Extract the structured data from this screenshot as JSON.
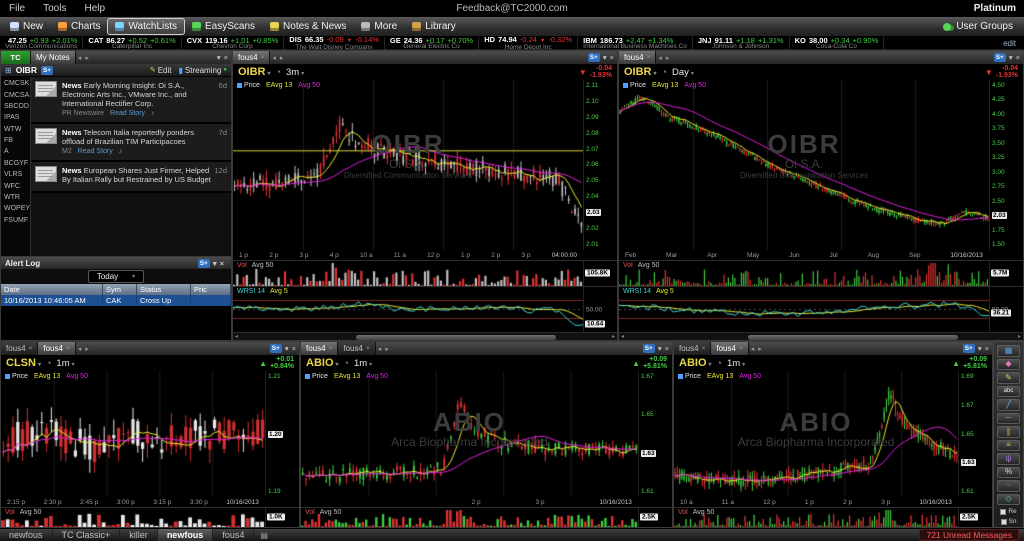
{
  "menubar": {
    "items": [
      "File",
      "Tools",
      "Help"
    ],
    "center": "Feedback@TC2000.com",
    "right": "Platinum"
  },
  "toolbar": {
    "buttons": [
      {
        "label": "New",
        "icon": "new-icon",
        "color": "#cfe2ff"
      },
      {
        "label": "Charts",
        "icon": "charts-icon",
        "color": "#ff9f40"
      },
      {
        "label": "WatchLists",
        "icon": "watchlists-icon",
        "color": "#7fd4ff",
        "active": true
      },
      {
        "label": "EasyScans",
        "icon": "easyscans-icon",
        "color": "#5ad45a"
      },
      {
        "label": "Notes & News",
        "icon": "notes-news-icon",
        "color": "#e8d44d"
      },
      {
        "label": "More",
        "icon": "more-icon",
        "color": "#bbbbbb"
      },
      {
        "label": "Library",
        "icon": "library-icon",
        "color": "#d4a24d"
      }
    ],
    "user_groups": {
      "label": "User Groups",
      "icon": "user-groups-icon",
      "color": "#5ad45a"
    }
  },
  "ticker": {
    "items": [
      {
        "symbol": "",
        "price": "47.25",
        "change": "+0.93",
        "pct": "+2.01%",
        "company": "Verizon Communications"
      },
      {
        "symbol": "CAT",
        "price": "86.27",
        "change": "+0.52",
        "pct": "+0.61%",
        "company": "Caterpillar Inc"
      },
      {
        "symbol": "CVX",
        "price": "119.16",
        "change": "+1.01",
        "pct": "+0.85%",
        "company": "Chevron Corp"
      },
      {
        "symbol": "DIS",
        "price": "66.35",
        "change": "-0.09",
        "pct": "-0.14%",
        "company": "The Walt Disney Company"
      },
      {
        "symbol": "GE",
        "price": "24.36",
        "change": "+0.17",
        "pct": "+0.70%",
        "company": "General Electric Co"
      },
      {
        "symbol": "HD",
        "price": "74.94",
        "change": "-0.24",
        "pct": "-0.32%",
        "company": "Home Depot Inc"
      },
      {
        "symbol": "IBM",
        "price": "186.73",
        "change": "+2.47",
        "pct": "+1.34%",
        "company": "International Business Machines Co"
      },
      {
        "symbol": "JNJ",
        "price": "91.11",
        "change": "+1.18",
        "pct": "+1.31%",
        "company": "Johnson & Johnson"
      },
      {
        "symbol": "KO",
        "price": "38.00",
        "change": "+0.34",
        "pct": "+0.90%",
        "company": "Coca-Cola Co"
      }
    ],
    "edit_link": "edit"
  },
  "watchlist": {
    "header": "TC",
    "symbols": [
      "CMCSK",
      "CMCSA",
      "SBCOD",
      "IPAS",
      "WTW",
      "FB",
      "A",
      "BCGYF",
      "VLRS",
      "WFC",
      "WTR",
      "WOPEY",
      "FSUMF"
    ]
  },
  "notes": {
    "title": "My Notes",
    "symbol": "OIBR",
    "edit_label": "Edit",
    "streaming_label": "Streaming",
    "items": [
      {
        "tag": "News",
        "headline": "Early Morning Insight: Oi S.A., Electronic Arts Inc., VMware Inc., and International Rectifier Corp.",
        "age": "6d",
        "source": "PR Newswire",
        "action": "Read Story"
      },
      {
        "tag": "News",
        "headline": "Telecom Italia reportedly ponders offload of Brazilian TIM Participacoes",
        "age": "7d",
        "source": "M2",
        "action": "Read Story"
      },
      {
        "tag": "News",
        "headline": "European Shares Just Firmer, Helped By Italian Rally but Restrained by US Budget",
        "age": "12d",
        "source": "",
        "action": ""
      }
    ]
  },
  "alert_log": {
    "title": "Alert Log",
    "filter": "Today",
    "columns": [
      "Date",
      "Sym",
      "Status",
      "Pric"
    ],
    "rows": [
      [
        "10/16/2013 10:46:05 AM",
        "CAK",
        "Cross Up",
        ""
      ]
    ]
  },
  "badges": {
    "splus": "S+"
  },
  "legend": {
    "price": "Price",
    "ema": "EAvg 13",
    "avg": "Avg 50"
  },
  "vol_legend": {
    "label1": "Vol",
    "label2": "Avg 50"
  },
  "wrsi_legend": {
    "label1": "WRSI 14",
    "label2": "Avg 5",
    "mid": "50.00"
  },
  "charts": {
    "main": {
      "tabs": [
        "fous4"
      ],
      "active_tab": 0,
      "symbol": "OIBR",
      "timeframe": "3m",
      "up": false,
      "change": "-0.04",
      "pct": "-1.93%",
      "y_labels": [
        "2.11",
        "2.10",
        "2.09",
        "2.08",
        "2.07",
        "2.06",
        "2.05",
        "2.04",
        "2.03",
        "2.02",
        "2.01"
      ],
      "box_index": 8,
      "times": [
        "1 p",
        "2 p",
        "3 p",
        "4 p",
        "10 a",
        "11 a",
        "12 p",
        "1 p",
        "2 p",
        "3 p",
        "04:00:00"
      ],
      "watermark": [
        "OIBR",
        "Oi S.A.",
        "Diversified Communication Services"
      ],
      "vol_value": "105.8K",
      "wrsi_value": "10.64",
      "wrsi_box_pos": 0.82
    },
    "daily": {
      "tabs": [
        "fous4"
      ],
      "active_tab": 0,
      "symbol": "OIBR",
      "timeframe": "Day",
      "up": false,
      "change": "-0.04",
      "pct": "-1.93%",
      "y_labels": [
        "4.50",
        "4.25",
        "4.00",
        "3.75",
        "3.50",
        "3.25",
        "3.00",
        "2.75",
        "2.50",
        "2.03",
        "1.75",
        "1.50"
      ],
      "box_index": 9,
      "times": [
        "Feb",
        "Mar",
        "Apr",
        "May",
        "Jun",
        "Jul",
        "Aug",
        "Sep",
        "10/16/2013"
      ],
      "watermark": [
        "OIBR",
        "Oi S.A.",
        "Diversified Communication Services"
      ],
      "vol_value": "5.7M",
      "wrsi_value": "36.21",
      "wrsi_box_pos": 0.58
    },
    "clsn": {
      "tabs": [
        "fous4",
        "fous4"
      ],
      "active_tab": 1,
      "symbol": "CLSN",
      "timeframe": "1m",
      "up": true,
      "change": "+0.01",
      "pct": "+0.84%",
      "y_labels": [
        "1.21",
        "1.20",
        "1.19"
      ],
      "box_index": 1,
      "times": [
        "2:15 p",
        "2:30 p",
        "2:45 p",
        "3:00 p",
        "3:15 p",
        "3:30 p",
        "10/16/2013"
      ],
      "vol_value": "1.0K"
    },
    "abio1": {
      "tabs": [
        "fous4",
        "fous4"
      ],
      "active_tab": 0,
      "symbol": "ABIO",
      "timeframe": "1m",
      "up": true,
      "change": "+0.09",
      "pct": "+5.81%",
      "y_labels": [
        "1.67",
        "1.65",
        "1.63",
        "1.61"
      ],
      "box_index": 2,
      "times": [
        "",
        "",
        "",
        "2 p",
        "3 p",
        "10/16/2013"
      ],
      "watermark": [
        "ABIO",
        "Arca Biopharma Incorporated"
      ],
      "vol_value": "2.5K"
    },
    "abio2": {
      "tabs": [
        "fous4",
        "fous4"
      ],
      "active_tab": 1,
      "symbol": "ABIO",
      "timeframe": "1m",
      "up": true,
      "change": "+0.09",
      "pct": "+5.81%",
      "y_labels": [
        "1.69",
        "1.67",
        "1.65",
        "1.63",
        "1.61"
      ],
      "box_index": 3,
      "times": [
        "10 a",
        "11 a",
        "12 p",
        "1 p",
        "2 p",
        "3 p",
        "10/16/2013"
      ],
      "watermark": [
        "ABIO",
        "Arca Biopharma Incorporated"
      ],
      "vol_value": "2.5K"
    }
  },
  "palette": {
    "tools": [
      {
        "name": "styles-icon",
        "glyph": "▦",
        "color": "#5aa0e0"
      },
      {
        "name": "eraser-icon",
        "glyph": "◆",
        "color": "#e07ab8"
      },
      {
        "name": "pencil-icon",
        "glyph": "✎",
        "color": "#e8d44d"
      },
      {
        "name": "text-note-icon",
        "glyph": "abc",
        "color": "#e8e8e8"
      },
      {
        "name": "trendline-icon",
        "glyph": "╱",
        "color": "#6fc0ff"
      },
      {
        "name": "horizontal-line-icon",
        "glyph": "─",
        "color": "#5ad45a"
      },
      {
        "name": "parallel-channel-icon",
        "glyph": "∥",
        "color": "#e8a04d"
      },
      {
        "name": "fibonacci-icon",
        "glyph": "≡",
        "color": "#d4b84d"
      },
      {
        "name": "pitchfork-icon",
        "glyph": "ψ",
        "color": "#b07ae0"
      },
      {
        "name": "percent-change-icon",
        "glyph": "%",
        "color": "#d8d8d8"
      },
      {
        "name": "zigzag-icon",
        "glyph": "~",
        "color": "#e05050"
      },
      {
        "name": "marker-icon",
        "glyph": "◇",
        "color": "#5ad4d4"
      }
    ],
    "toggles": [
      {
        "name": "re-toggle",
        "label": "Re"
      },
      {
        "name": "snap-toggle",
        "label": "Sn"
      }
    ]
  },
  "bottom_bar": {
    "tabs": [
      "newfous",
      "TC Classic+",
      "killer",
      "newfous",
      "fous4"
    ],
    "active_index": 3,
    "messages": "721 Unread Messages"
  },
  "glyphs": {
    "caret_down": "▾",
    "close": "×",
    "prev": "◂",
    "next": "▸",
    "up_arrow": "▲",
    "down_arrow": "▼",
    "clock": "◔",
    "pencil": "✎",
    "speaker": "♪",
    "grid": "⊞",
    "stream_bar": "▮",
    "dot": "●",
    "page": "▤"
  },
  "colors": {
    "up_green": "#3fcf3f",
    "down_red": "#e03434",
    "ema_yellow": "#e8e832",
    "avg_magenta": "#e020e0",
    "wrsi_cyan": "#40d0d0",
    "axis_green": "#46d146",
    "accent_blue": "#2f6fbe",
    "link_blue": "#5b9bd5",
    "alert_yellow": "#d8d832",
    "unread_red": "#ff5c5c"
  }
}
